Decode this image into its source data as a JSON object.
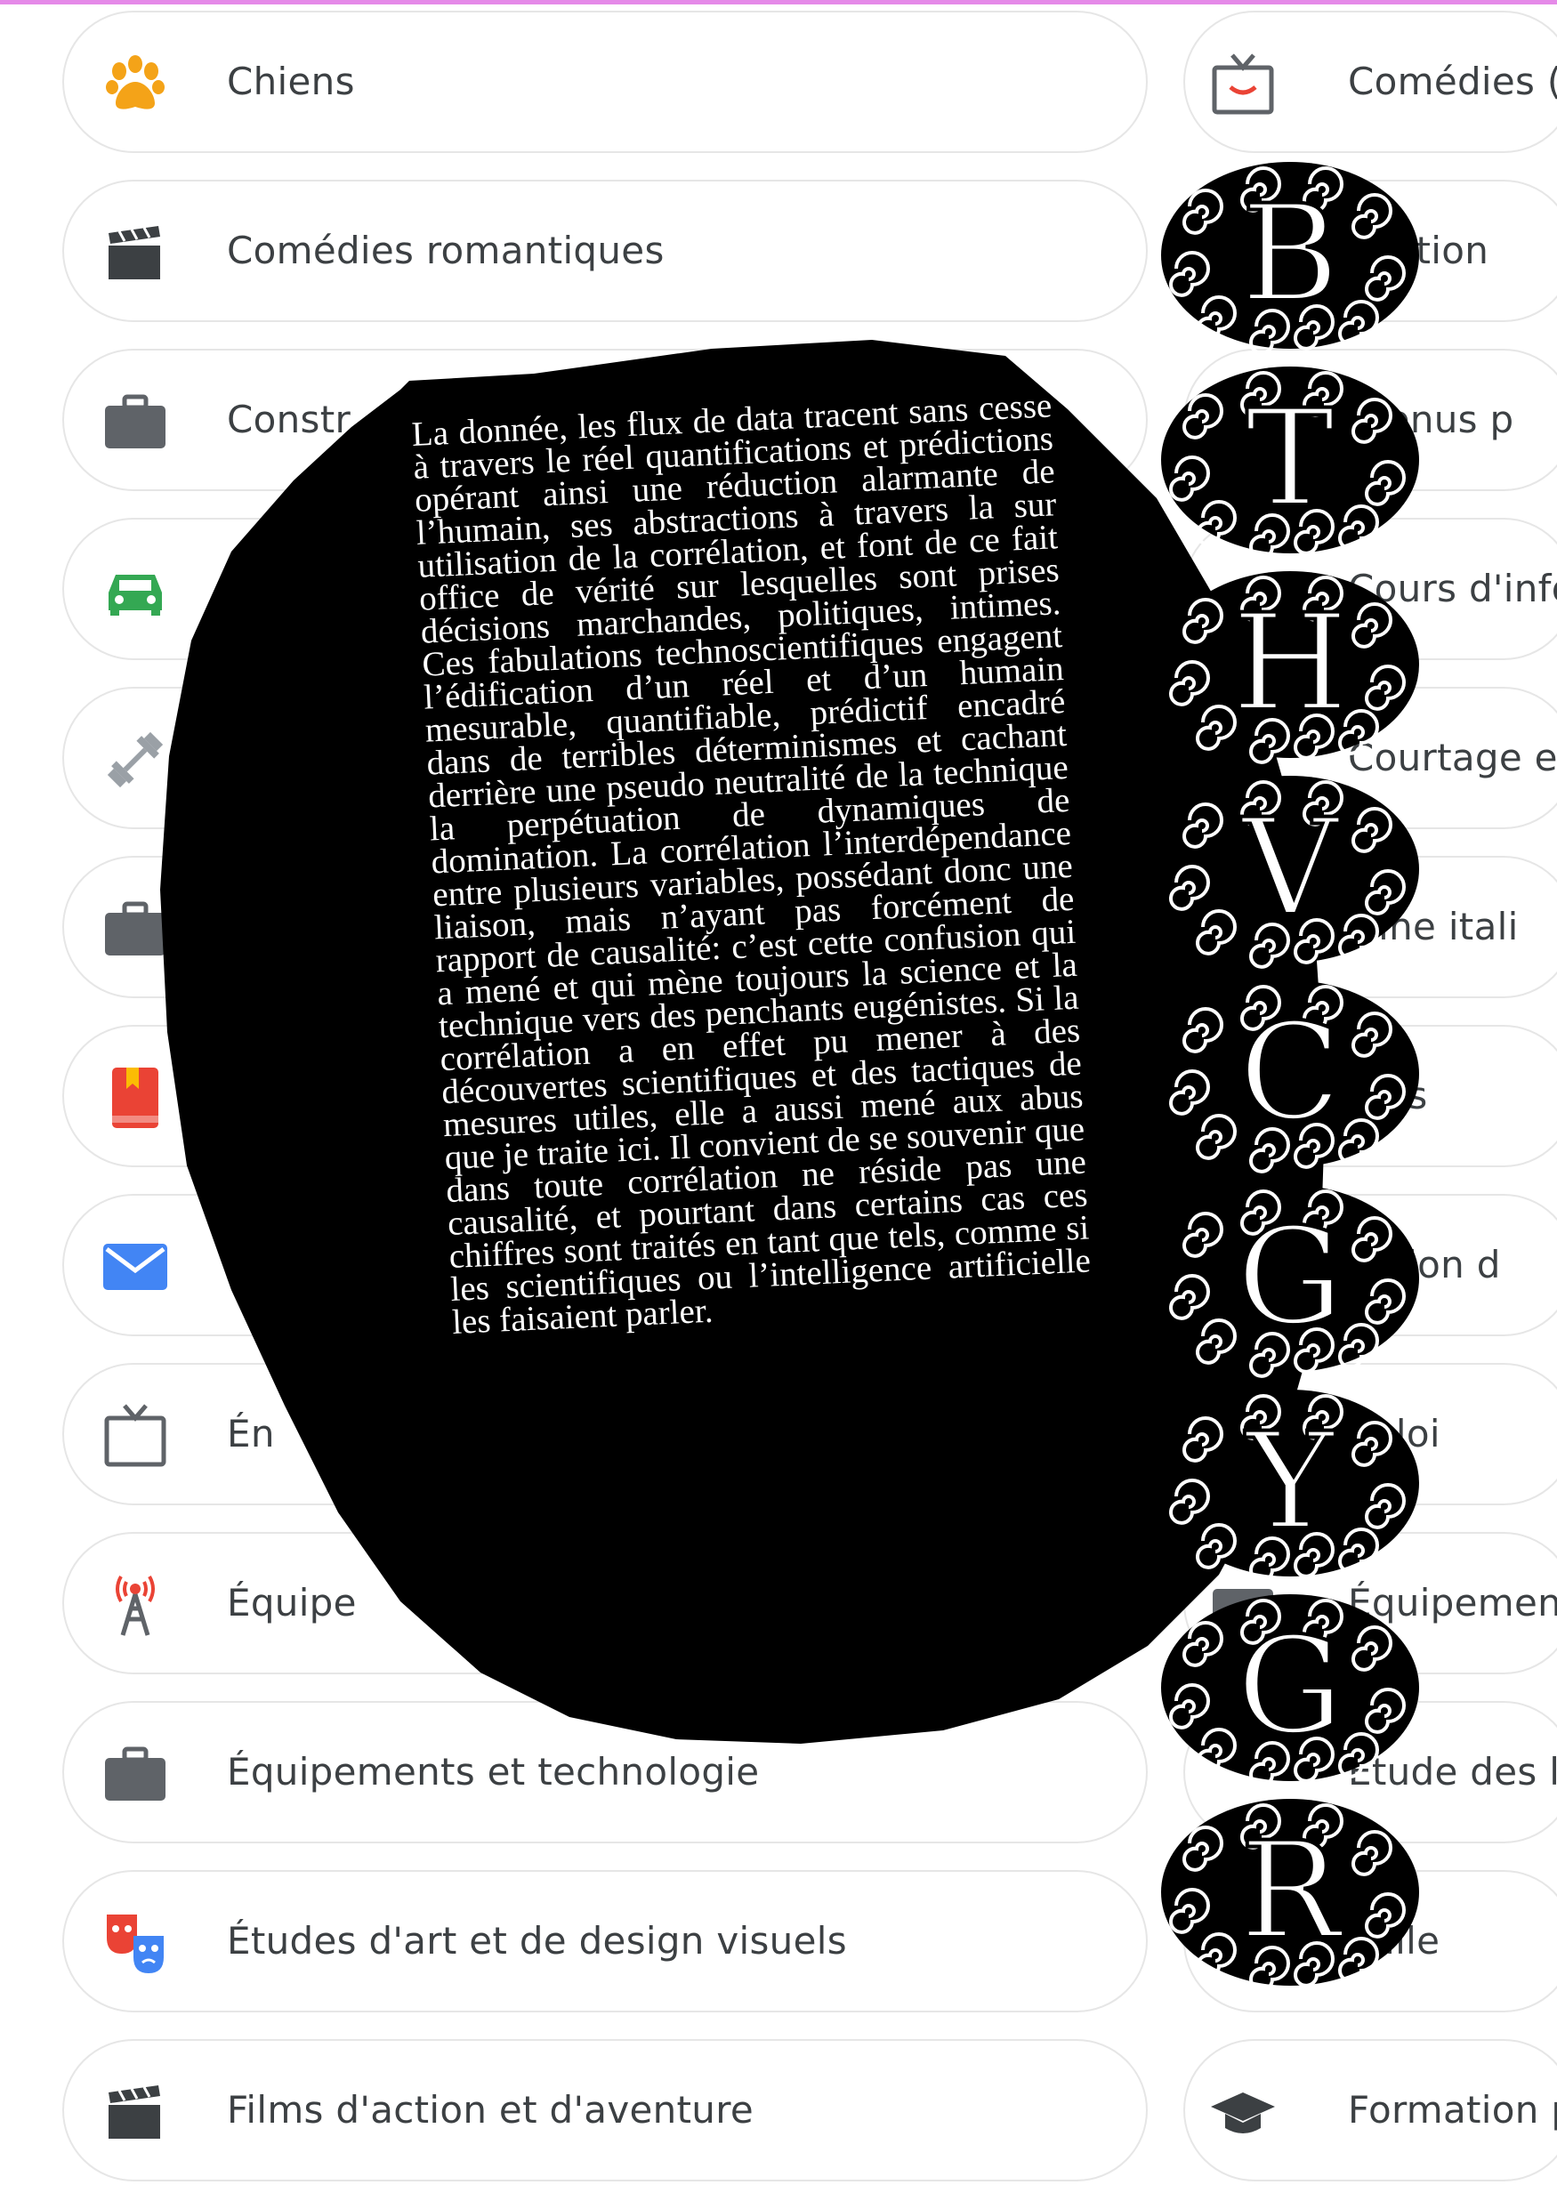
{
  "categories_left": [
    {
      "label": "Chiens",
      "icon": "paw-icon"
    },
    {
      "label": "Comédies romantiques",
      "icon": "clapperboard-icon"
    },
    {
      "label": "Constr",
      "icon": "briefcase-icon"
    },
    {
      "label": "",
      "icon": "car-icon"
    },
    {
      "label": "",
      "icon": "dumbbell-icon"
    },
    {
      "label": "",
      "icon": "briefcase-icon"
    },
    {
      "label": "",
      "icon": "book-icon"
    },
    {
      "label": "",
      "icon": "mail-icon"
    },
    {
      "label": "Én",
      "icon": "tv-icon"
    },
    {
      "label": "Équipe",
      "icon": "antenna-icon"
    },
    {
      "label": "Équipements et technologie",
      "icon": "briefcase-icon"
    },
    {
      "label": "Études d'art et de design visuels",
      "icon": "theater-masks-icon"
    },
    {
      "label": "Films d'action et d'aventure",
      "icon": "clapperboard-icon"
    }
  ],
  "categories_right": [
    {
      "label": "Comédies (",
      "icon": "tv-smile-icon"
    },
    {
      "label": "ception",
      "icon": "palette-icon"
    },
    {
      "label": "ntenus p",
      "icon": "search-icon"
    },
    {
      "label": "Cours d'info",
      "icon": "laptop-icon"
    },
    {
      "label": "Courtage e",
      "icon": "briefcase-icon"
    },
    {
      "label": "isine itali",
      "icon": "pasta-icon"
    },
    {
      "label": "mes",
      "icon": "shield-icon"
    },
    {
      "label": "cation d",
      "icon": "graduation-icon"
    },
    {
      "label": "nploi",
      "icon": "briefcase-icon"
    },
    {
      "label": "Équipement",
      "icon": "briefcase-icon"
    },
    {
      "label": "Étude des la",
      "icon": "translate-icon"
    },
    {
      "label": "mille",
      "icon": "family-icon"
    },
    {
      "label": "Formation p",
      "icon": "graduation-cap-icon"
    }
  ],
  "overlay_text": "La donnée, les flux de data tracent sans cesse à travers le réel quantifications et prédictions opérant ainsi une réduction alarmante de l’humain, ses abstractions à travers la sur utilisation de la corrélation, et font de ce fait office de vérité sur lesquelles sont prises décisions marchandes, politiques, intimes. Ces fabulations technoscientifiques engagent l’édification d’un réel et d’un humain mesurable, quantifiable, prédictif encadré dans de terribles déterminismes et cachant derrière une pseudo neutralité de la technique la perpétuation de dynamiques de domination. La corrélation l’interdépendance entre plusieurs variables, possédant donc une liaison, mais n’ayant pas forcément de rapport de causalité: c’est cette confusion qui a mené et qui mène toujours la science et la technique vers des penchants eugénistes. Si la corrélation a en effet pu mener à des découvertes scientifiques et des tactiques de mesures utiles, elle a aussi mené aux abus que je traite ici. Il convient de se souvenir que dans toute corrélation ne réside pas une causalité, et pourtant dans certains cas ces chiffres sont traités en tant que tels, comme si les scientifiques ou l’intelligence artificielle les faisaient parler.",
  "badge_letters": [
    "B",
    "T",
    "H",
    "V",
    "C",
    "G",
    "Y",
    "G",
    "R"
  ],
  "colors": {
    "pill_border": "#e6e6e6",
    "label": "#3c4043",
    "overlay": "#000000",
    "overlay_text": "#ffffff"
  }
}
